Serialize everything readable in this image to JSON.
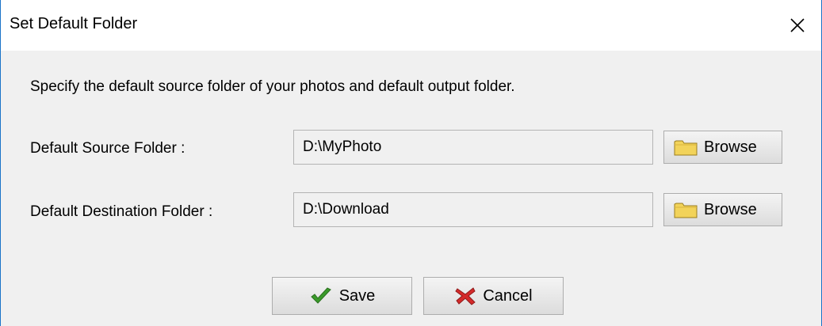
{
  "window": {
    "title": "Set Default Folder"
  },
  "dialog": {
    "instruction": "Specify the default source folder of your photos and default output folder.",
    "source": {
      "label": "Default Source Folder :",
      "value": "D:\\MyPhoto",
      "browse_label": "Browse"
    },
    "destination": {
      "label": "Default Destination Folder :",
      "value": "D:\\Download",
      "browse_label": "Browse"
    },
    "save_label": "Save",
    "cancel_label": "Cancel"
  },
  "icons": {
    "close": "close-icon",
    "folder": "folder-icon",
    "save": "checkmark-icon",
    "cancel": "red-x-icon"
  },
  "colors": {
    "window_border": "#1a73c8",
    "dialog_background": "#f0f0f0",
    "save_check": "#3a9a2a",
    "cancel_x": "#d42a2a",
    "folder": "#f2d35a"
  }
}
